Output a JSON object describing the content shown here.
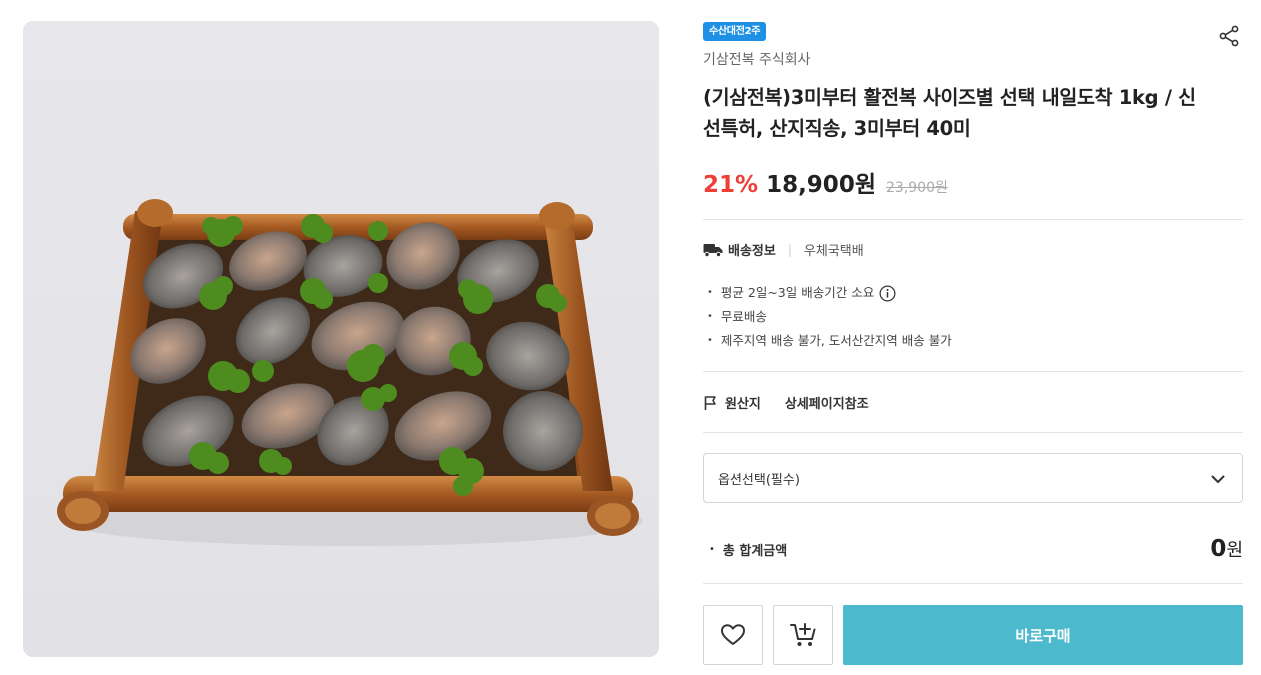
{
  "product": {
    "badge": "수산대전2주",
    "seller": "기삼전복 주식회사",
    "title": "(기삼전복)3미부터 활전복 사이즈별 선택 내일도착 1kg / 신선특허, 산지직송, 3미부터 40미",
    "discount": "21%",
    "price": "18,900원",
    "original_price": "23,900원",
    "image_alt": "abalone on bamboo tray"
  },
  "shipping": {
    "label": "배송정보",
    "carrier": "우체국택배",
    "details": [
      "평균 2일~3일 배송기간 소요",
      "무료배송",
      "제주지역 배송 불가, 도서산간지역 배송 불가"
    ]
  },
  "origin": {
    "label": "원산지",
    "value": "상세페이지참조"
  },
  "option_select": {
    "placeholder": "옵션선택(필수)"
  },
  "total": {
    "label": "총 합계금액",
    "amount": "0",
    "unit": "원"
  },
  "actions": {
    "buy_label": "바로구매"
  },
  "colors": {
    "accent": "#4cbacc",
    "discount": "#ef3e36",
    "badge": "#1e90e6"
  },
  "icons": [
    "share-icon",
    "truck-icon",
    "info-icon",
    "flag-icon",
    "chevron-down-icon",
    "heart-icon",
    "cart-add-icon"
  ]
}
